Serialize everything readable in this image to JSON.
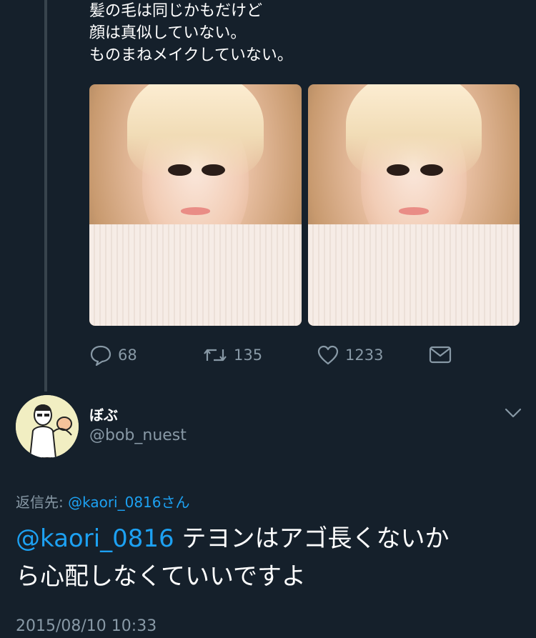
{
  "tweet": {
    "text_lines": [
      "髪の毛は同じかもだけど",
      "顔は真似していない。",
      "ものまねメイクしていない。"
    ],
    "media": [
      {
        "alt": "photo-1"
      },
      {
        "alt": "photo-2"
      }
    ],
    "actions": {
      "reply_count": "68",
      "retweet_count": "135",
      "like_count": "1233"
    }
  },
  "reply": {
    "user": {
      "display_name": "ぼぶ",
      "handle": "@bob_nuest"
    },
    "reply_to_label": "返信先:",
    "reply_to_link": "@kaori_0816さん",
    "mention": "@kaori_0816",
    "text_line1": " テヨンはアゴ長くないか",
    "text_line2": "ら心配しなくていいですよ",
    "timestamp": "2015/08/10 10:33"
  },
  "colors": {
    "background": "#15202b",
    "accent": "#1da1f2",
    "muted": "#8899a6"
  },
  "icons": [
    "reply-icon",
    "retweet-icon",
    "like-icon",
    "message-icon",
    "chevron-down-icon"
  ]
}
